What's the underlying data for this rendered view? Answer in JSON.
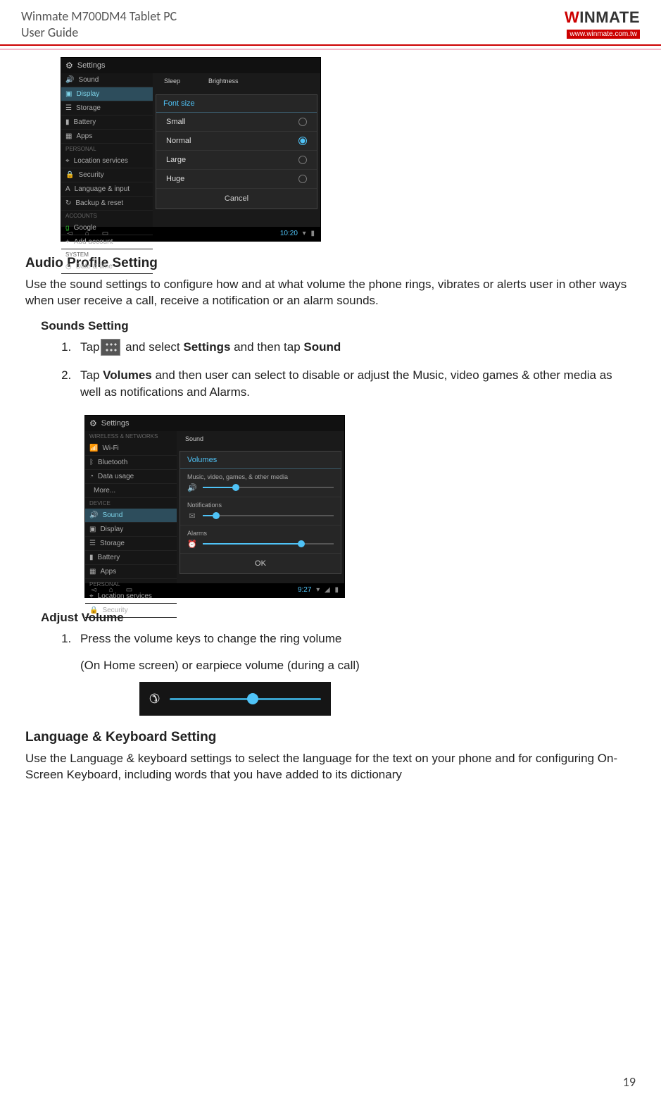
{
  "header": {
    "product": "Winmate M700DM4 Tablet PC",
    "doc": "User Guide",
    "logo_text": "WINMATE",
    "logo_url": "www.winmate.com.tw"
  },
  "ss1": {
    "title": "Settings",
    "sidebar_top": "Sound",
    "sidebar": [
      "Display",
      "Storage",
      "Battery",
      "Apps"
    ],
    "cat1": "PERSONAL",
    "personal": [
      "Location services",
      "Security",
      "Language & input",
      "Backup & reset"
    ],
    "cat2": "ACCOUNTS",
    "accounts": [
      "Google",
      "Add account"
    ],
    "cat3": "SYSTEM",
    "system": [
      "Date & time"
    ],
    "main_labels": {
      "sleep": "Sleep",
      "brightness": "Brightness"
    },
    "dialog": {
      "title": "Font size",
      "opts": [
        "Small",
        "Normal",
        "Large",
        "Huge"
      ],
      "cancel": "Cancel"
    },
    "time": "10:20"
  },
  "sections": {
    "audio_title": "Audio Profile Setting",
    "audio_body": "Use the sound settings to configure how and at what volume the phone rings, vibrates or alerts user in other ways when user receive a call, receive a notification or an alarm sounds.",
    "sounds_title": "Sounds Setting",
    "step1_a": "Tap",
    "step1_b": " and select ",
    "step1_settings": "Settings",
    "step1_c": " and then tap ",
    "step1_sound": "Sound",
    "step2_a": "Tap ",
    "step2_vol": "Volumes",
    "step2_b": " and then user can select to disable or adjust the Music, video games & other media as well as notifications and Alarms.",
    "adjust_title": "Adjust Volume",
    "adjust_step1": "Press the volume keys to change the ring volume",
    "adjust_sub": "(On Home screen) or earpiece volume (during a call)",
    "lang_title": "Language & Keyboard Setting",
    "lang_body": "Use the Language & keyboard settings to select the language for the text on your phone and for configuring On-Screen Keyboard, including words that you have added to its dictionary"
  },
  "ss2": {
    "title": "Settings",
    "cat_wn": "WIRELESS & NETWORKS",
    "wn": [
      "Wi-Fi",
      "Bluetooth",
      "Data usage",
      "More..."
    ],
    "cat_dev": "DEVICE",
    "dev": [
      "Sound",
      "Display",
      "Storage",
      "Battery",
      "Apps"
    ],
    "cat_pers": "PERSONAL",
    "pers": [
      "Location services",
      "Security"
    ],
    "main_hdr": "Sound",
    "dialog": {
      "title": "Volumes",
      "row1": "Music, video, games, & other media",
      "row2": "Notifications",
      "row3": "Alarms",
      "ok": "OK"
    },
    "time": "9:27"
  },
  "page_number": "19"
}
